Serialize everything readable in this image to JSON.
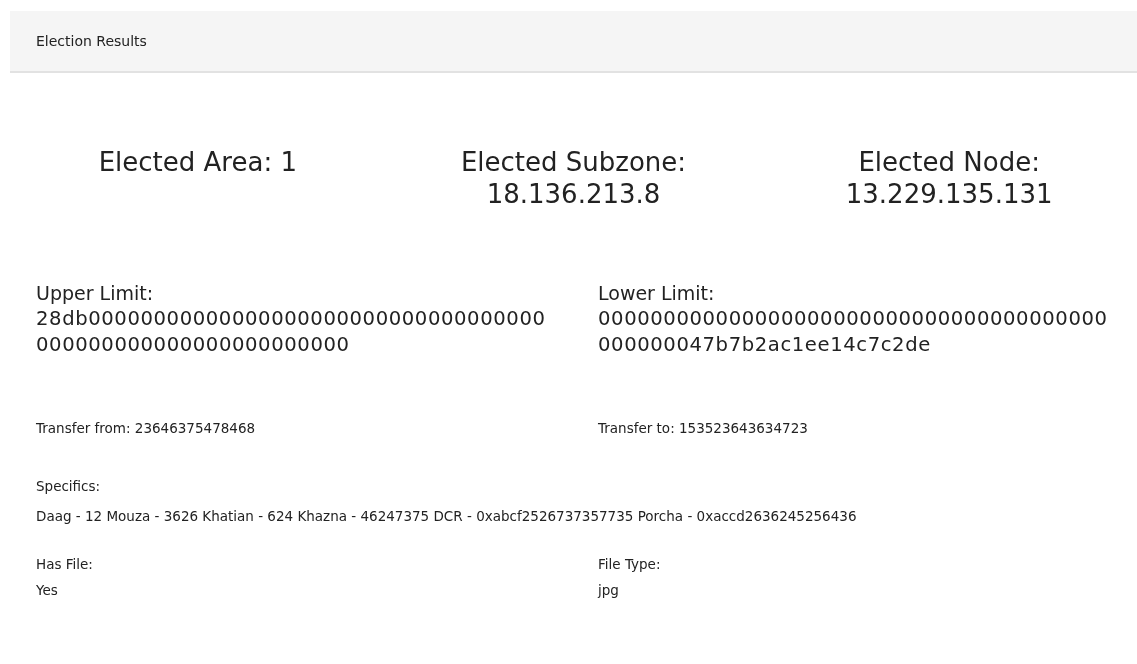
{
  "header": {
    "title": "Election Results"
  },
  "elected": [
    {
      "label": "Elected Area: 1"
    },
    {
      "label": "Elected Subzone:",
      "value": "18.136.213.8"
    },
    {
      "label": "Elected Node:",
      "value": "13.229.135.131"
    }
  ],
  "limits": [
    {
      "label": "Upper Limit:",
      "value": "28db00000000000000000000000000000000000000000000000000000000000"
    },
    {
      "label": "Lower Limit:",
      "value": "000000000000000000000000000000000000000000000047b7b2ac1ee14c7c2de"
    }
  ],
  "transfers": [
    {
      "text": "Transfer from: 23646375478468"
    },
    {
      "text": "Transfer to: 153523643634723"
    }
  ],
  "specifics": {
    "label": "Specifics:",
    "value": "Daag - 12 Mouza - 3626 Khatian - 624 Khazna - 46247375 DCR - 0xabcf2526737357735 Porcha - 0xaccd2636245256436"
  },
  "file_info": [
    {
      "label": "Has File:",
      "value": "Yes"
    },
    {
      "label": "File Type:",
      "value": "jpg"
    }
  ]
}
